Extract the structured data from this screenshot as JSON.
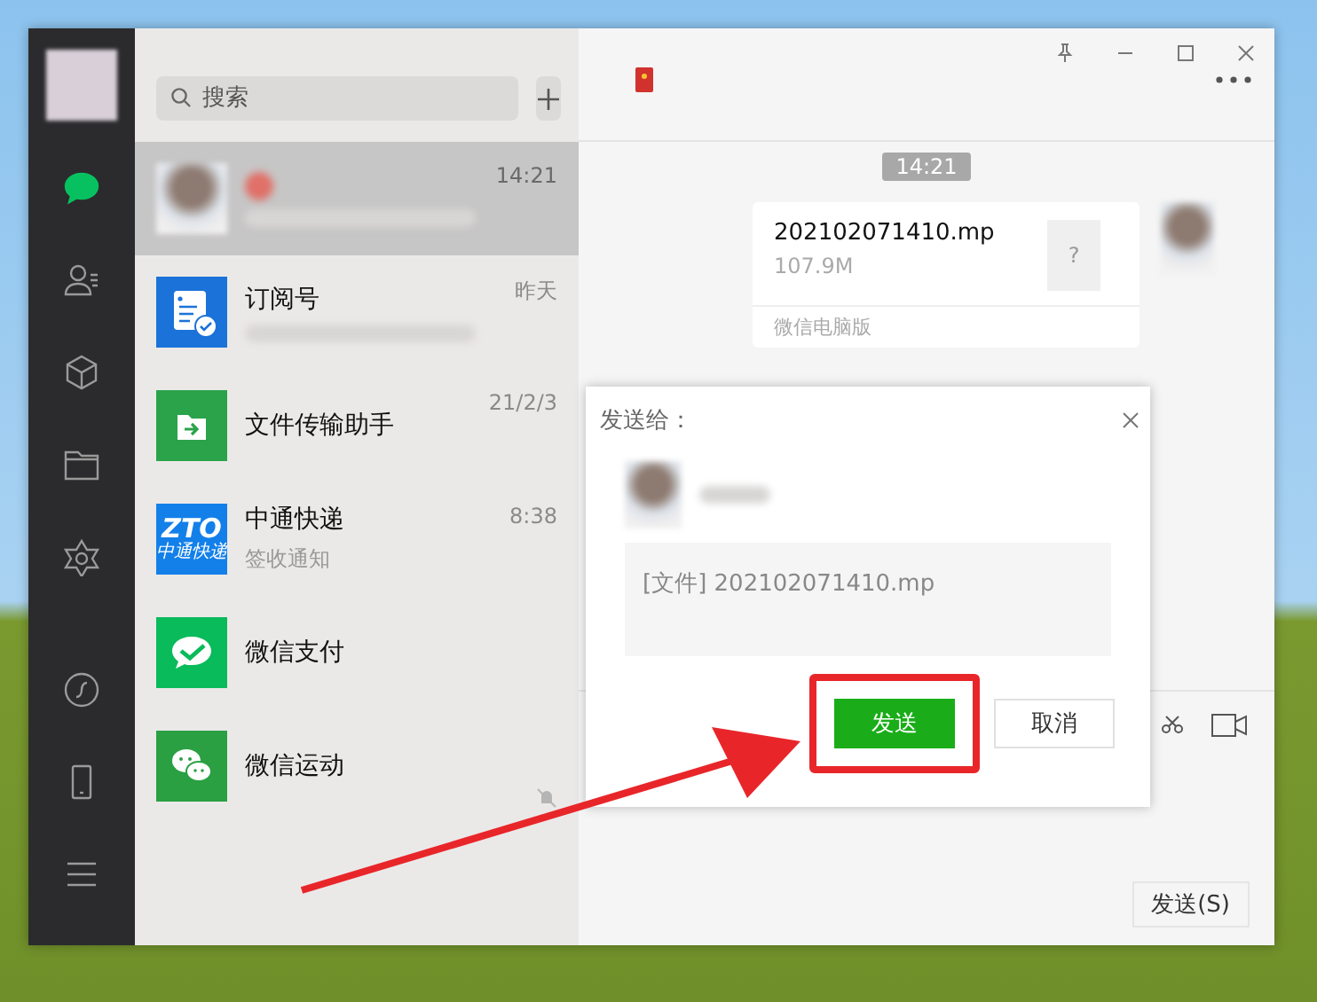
{
  "sidebar": {
    "nav": [
      {
        "kind": "chats",
        "selected": true
      },
      {
        "kind": "contacts",
        "selected": false
      },
      {
        "kind": "favorites",
        "selected": false
      },
      {
        "kind": "files",
        "selected": false
      },
      {
        "kind": "moments",
        "selected": false
      }
    ],
    "bottom": [
      {
        "kind": "mini-programs"
      },
      {
        "kind": "phone"
      },
      {
        "kind": "menu"
      }
    ]
  },
  "search": {
    "placeholder": "搜索"
  },
  "chats": [
    {
      "kind": "photo",
      "time": "14:21",
      "selected": true,
      "muted": false
    },
    {
      "kind": "subscription",
      "name": "订阅号",
      "time": "昨天",
      "selected": false,
      "muted": false
    },
    {
      "kind": "file-transfer",
      "name": "文件传输助手",
      "time": "21/2/3",
      "selected": false,
      "muted": false
    },
    {
      "kind": "zto",
      "logo_text": "ZTO",
      "logo_caption": "中通快递",
      "name": "中通快递",
      "preview": "签收通知",
      "time": "8:38",
      "selected": false,
      "muted": false
    },
    {
      "kind": "pay",
      "name": "微信支付",
      "selected": false,
      "muted": false
    },
    {
      "kind": "sport",
      "name": "微信运动",
      "selected": false,
      "muted": true
    }
  ],
  "chat": {
    "time_badge": "14:21",
    "message": {
      "file_name": "202102071410.mp",
      "file_size": "107.9M",
      "file_glyph": "?",
      "footer": "微信电脑版"
    },
    "send_button": "发送(S)"
  },
  "dialog": {
    "title": "发送给：",
    "content": "[文件] 202102071410.mp",
    "buttons": [
      {
        "kind": "primary",
        "label": "发送"
      },
      {
        "kind": "secondary",
        "label": "取消"
      }
    ]
  },
  "annotation": {
    "highlight": true,
    "arrow": true
  }
}
